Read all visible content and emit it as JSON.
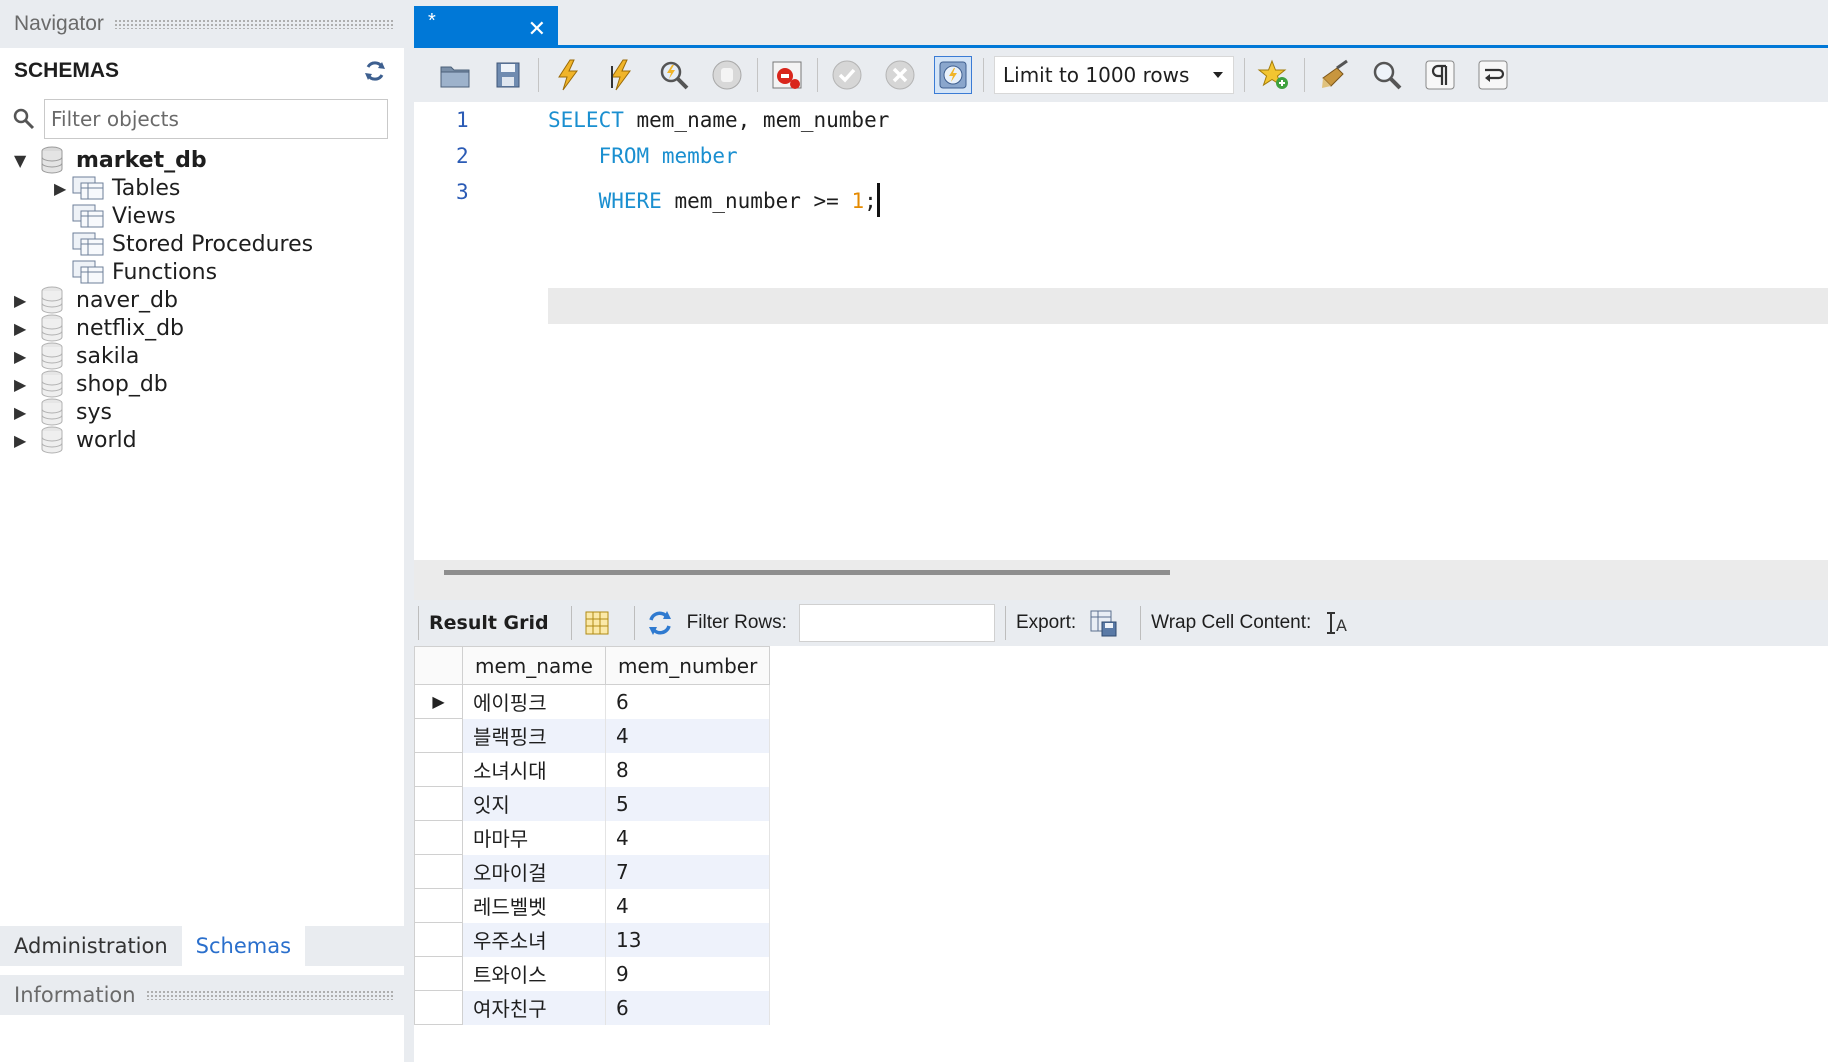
{
  "navigator": {
    "title": "Navigator",
    "schemas_label": "SCHEMAS",
    "filter_placeholder": "Filter objects",
    "schemas": [
      {
        "name": "market_db",
        "expanded": true,
        "children": [
          "Tables",
          "Views",
          "Stored Procedures",
          "Functions"
        ]
      },
      {
        "name": "naver_db"
      },
      {
        "name": "netflix_db"
      },
      {
        "name": "sakila"
      },
      {
        "name": "shop_db"
      },
      {
        "name": "sys"
      },
      {
        "name": "world"
      }
    ],
    "bottom_tabs": [
      "Administration",
      "Schemas"
    ],
    "active_bottom_tab": "Schemas",
    "info_title": "Information"
  },
  "editor": {
    "tab_title": "*",
    "limit_label": "Limit to 1000 rows",
    "lines": [
      {
        "num": "1",
        "parts": [
          {
            "t": "SELECT",
            "k": "kw"
          },
          {
            "t": " mem_name, mem_number",
            "k": ""
          }
        ]
      },
      {
        "num": "2",
        "parts": [
          {
            "t": "    FROM",
            "k": "kw"
          },
          {
            "t": " ",
            "k": ""
          },
          {
            "t": "member",
            "k": "kw"
          }
        ]
      },
      {
        "num": "3",
        "parts": [
          {
            "t": "    WHERE",
            "k": "kw"
          },
          {
            "t": " mem_number >= ",
            "k": ""
          },
          {
            "t": "1",
            "k": "num"
          },
          {
            "t": ";",
            "k": ""
          }
        ]
      }
    ]
  },
  "results": {
    "result_grid_label": "Result Grid",
    "filter_rows_label": "Filter Rows:",
    "export_label": "Export:",
    "wrap_label": "Wrap Cell Content:",
    "columns": [
      "mem_name",
      "mem_number"
    ],
    "rows": [
      [
        "에이핑크",
        "6"
      ],
      [
        "블랙핑크",
        "4"
      ],
      [
        "소녀시대",
        "8"
      ],
      [
        "잇지",
        "5"
      ],
      [
        "마마무",
        "4"
      ],
      [
        "오마이걸",
        "7"
      ],
      [
        "레드벨벳",
        "4"
      ],
      [
        "우주소녀",
        "13"
      ],
      [
        "트와이스",
        "9"
      ],
      [
        "여자친구",
        "6"
      ]
    ]
  },
  "colors": {
    "accent": "#0078d7",
    "keyword": "#1a8fd0",
    "number": "#e58a00",
    "alt_row": "#eef2fb"
  }
}
